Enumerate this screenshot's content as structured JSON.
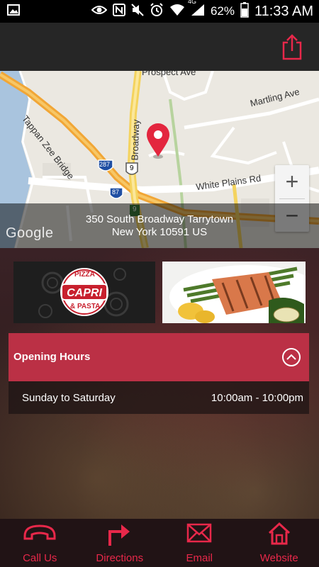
{
  "status_bar": {
    "network": "4G",
    "battery": "62%",
    "time": "11:33 AM"
  },
  "map": {
    "labels": {
      "prospect_ave": "Prospect Ave",
      "martling_ave": "Martling Ave",
      "tappan_zee_bridge": "Tappan Zee Bridge",
      "broadway": "Broadway",
      "white_plains_rd": "White Plains Rd",
      "shield_287": "287",
      "shield_9_a": "9",
      "shield_87": "87",
      "shield_9_b": "9"
    },
    "zoom_in": "+",
    "zoom_out": "−",
    "address_line1": "350 South Broadway Tarrytown",
    "address_line2": "New York 10591 US",
    "attribution": "Google"
  },
  "logo": {
    "line1": "PIZZA",
    "name": "CAPRI",
    "line2": "& PASTA"
  },
  "opening_hours": {
    "title": "Opening Hours",
    "rows": [
      {
        "days": "Sunday to Saturday",
        "time": "10:00am - 10:00pm"
      }
    ]
  },
  "bottom_nav": [
    {
      "label": "Call Us",
      "icon": "phone-icon"
    },
    {
      "label": "Directions",
      "icon": "directions-arrow-icon"
    },
    {
      "label": "Email",
      "icon": "envelope-icon"
    },
    {
      "label": "Website",
      "icon": "home-icon"
    }
  ],
  "colors": {
    "accent": "#e8284a",
    "header_bar": "#bb3045",
    "app_bar": "#262626"
  }
}
